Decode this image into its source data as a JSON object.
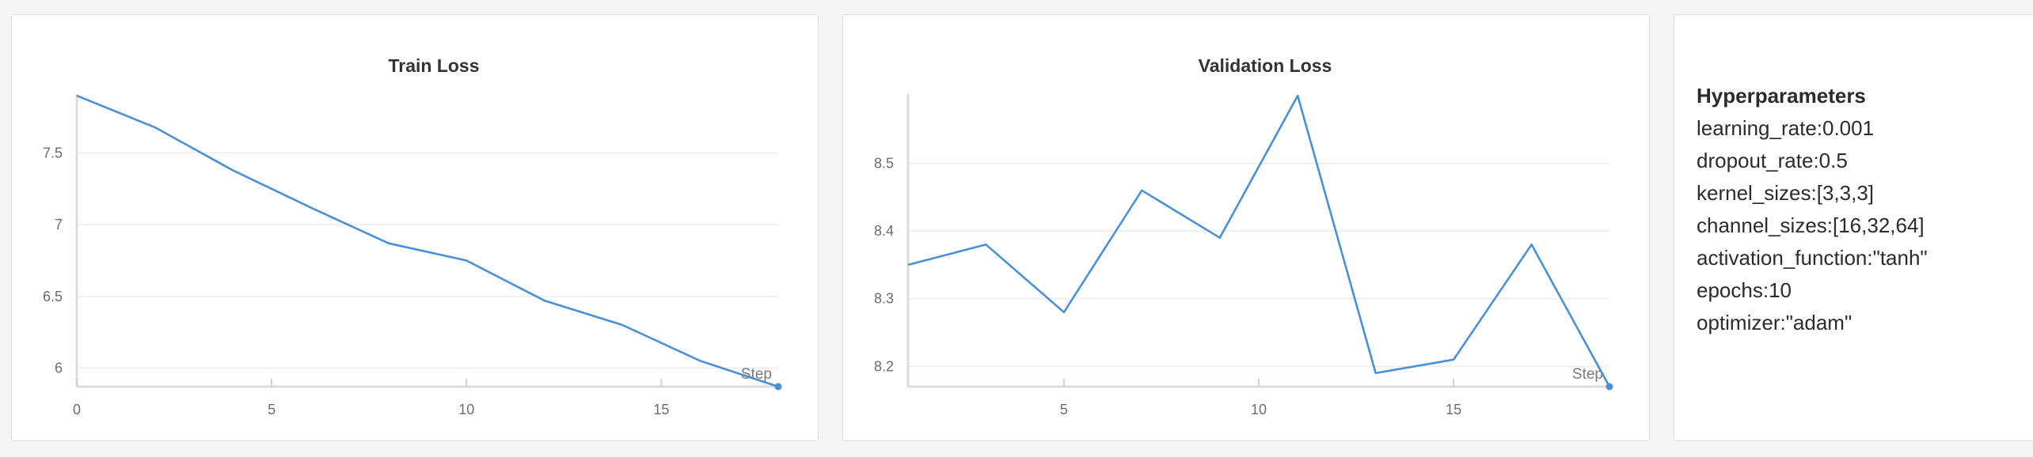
{
  "chart_data": [
    {
      "type": "line",
      "title": "Train Loss",
      "xlabel": "Step",
      "ylabel": "",
      "xlim": [
        0,
        18
      ],
      "ylim": [
        5.87,
        7.9
      ],
      "xticks": [
        0,
        5,
        10,
        15
      ],
      "yticks": [
        6,
        6.5,
        7,
        7.5
      ],
      "ytick_labels": [
        "6",
        "6.5",
        "7",
        "7.5"
      ],
      "grid": true,
      "series": [
        {
          "x": [
            0,
            2,
            4,
            6,
            8,
            10,
            12,
            14,
            16,
            18
          ],
          "values": [
            7.9,
            7.68,
            7.38,
            7.12,
            6.87,
            6.75,
            6.47,
            6.3,
            6.05,
            5.87
          ]
        }
      ]
    },
    {
      "type": "line",
      "title": "Validation Loss",
      "xlabel": "Step",
      "ylabel": "",
      "xlim": [
        1,
        19
      ],
      "ylim": [
        8.17,
        8.6
      ],
      "xticks": [
        5,
        10,
        15
      ],
      "yticks": [
        8.2,
        8.3,
        8.4,
        8.5
      ],
      "ytick_labels": [
        "8.2",
        "8.3",
        "8.4",
        "8.5"
      ],
      "grid": true,
      "series": [
        {
          "x": [
            1,
            3,
            5,
            7,
            9,
            11,
            13,
            15,
            17,
            19
          ],
          "values": [
            8.35,
            8.38,
            8.28,
            8.46,
            8.39,
            8.6,
            8.19,
            8.21,
            8.38,
            8.17
          ]
        }
      ]
    }
  ],
  "colors": {
    "series_line": "#4a90d9"
  },
  "hyperparameters": {
    "title": "Hyperparameters",
    "lines": [
      "learning_rate:0.001",
      "dropout_rate:0.5",
      "kernel_sizes:[3,3,3]",
      "channel_sizes:[16,32,64]",
      "activation_function:\"tanh\"",
      "epochs:10",
      "optimizer:\"adam\""
    ]
  }
}
